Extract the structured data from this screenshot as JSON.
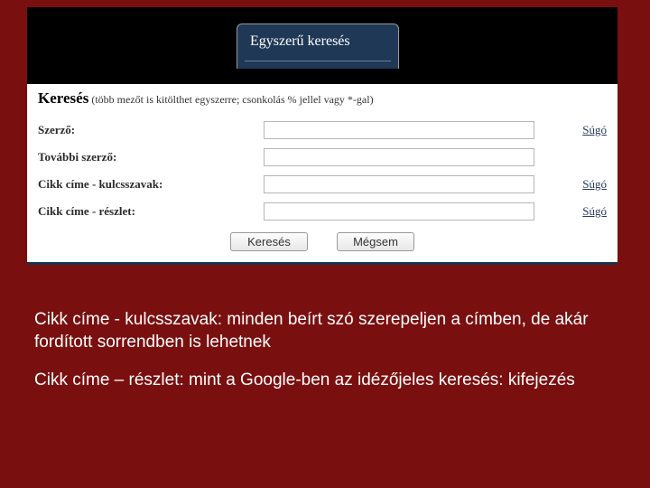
{
  "tab": {
    "label": "Egyszerű keresés"
  },
  "heading": {
    "strong": "Keresés",
    "hint": "(több mezőt is kitölthet egyszerre; csonkolás % jellel vagy *-gal)"
  },
  "fields": [
    {
      "label": "Szerző:",
      "help": "Súgó"
    },
    {
      "label": "További szerző:",
      "help": ""
    },
    {
      "label": "Cikk címe - kulcsszavak:",
      "help": "Súgó"
    },
    {
      "label": "Cikk címe - részlet:",
      "help": "Súgó"
    }
  ],
  "buttons": {
    "search": "Keresés",
    "cancel": "Mégsem"
  },
  "notes": {
    "p1": "Cikk címe - kulcsszavak: minden beírt szó szerepeljen a címben, de akár fordított sorrendben is lehetnek",
    "p2": "Cikk címe – részlet: mint a Google-ben az idézőjeles keresés: kifejezés"
  }
}
